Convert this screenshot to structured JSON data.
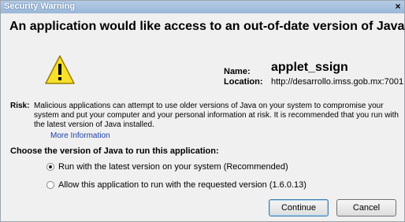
{
  "window": {
    "title": "Security Warning",
    "close_glyph": "×"
  },
  "headline": "An application would like access to an out-of-date version of Java.",
  "icon": "warning-icon",
  "app": {
    "name_label": "Name:",
    "name": "applet_ssign",
    "location_label": "Location:",
    "location": "http://desarrollo.imss.gob.mx:7001"
  },
  "risk": {
    "label": "Risk:",
    "text": "Malicious applications can attempt to use older versions of Java on your system to compromise your system and put your computer and your personal information at risk. It is recommended that you run with the latest version of Java installed.",
    "more_info": "More Information"
  },
  "choice": {
    "heading": "Choose the version of Java to run this application:",
    "options": [
      {
        "label": "Run with the latest version on your system (Recommended)",
        "selected": true
      },
      {
        "label": "Allow this application to run with the requested version (1.6.0.13)",
        "selected": false
      }
    ]
  },
  "buttons": {
    "continue": "Continue",
    "cancel": "Cancel"
  }
}
